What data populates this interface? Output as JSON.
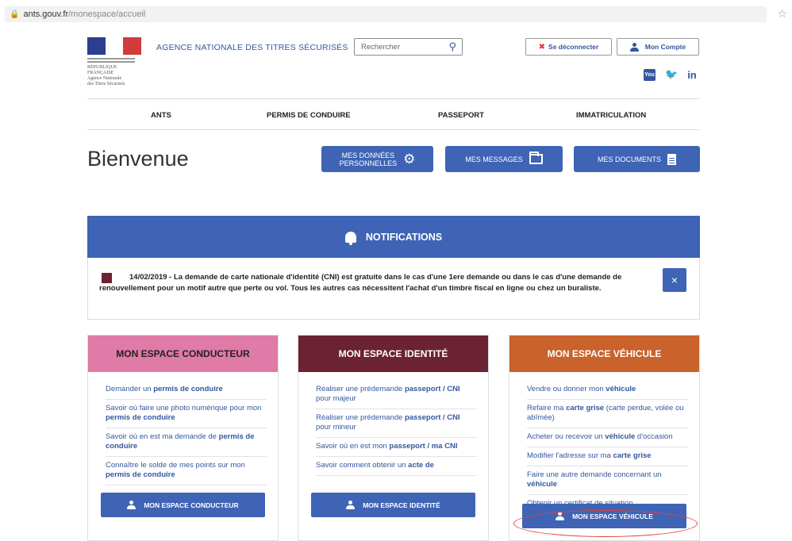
{
  "browser": {
    "url_host": "ants.gouv.fr",
    "url_path": "/monespace/accueil"
  },
  "header": {
    "agency": "AGENCE NATIONALE DES TITRES SÉCURISÉS",
    "search_placeholder": "Rechercher",
    "logout_label": "Se déconnecter",
    "account_label": "Mon Compte",
    "logo_lines": [
      "RÉPUBLIQUE FRANÇAISE",
      "Agence Nationale",
      "des Titres Sécurisés"
    ],
    "social": {
      "twitter": "🐦",
      "linkedin": "in",
      "youtube": "You"
    }
  },
  "nav": [
    "ANTS",
    "PERMIS DE CONDUIRE",
    "PASSEPORT",
    "IMMATRICULATION"
  ],
  "page_title": "Bienvenue",
  "top_buttons": {
    "donnees_line1": "MES DONNÉES",
    "donnees_line2": "PERSONNELLES",
    "messages": "MES MESSAGES",
    "documents": "MES DOCUMENTS"
  },
  "notifications": {
    "title": "NOTIFICATIONS",
    "text": "14/02/2019 - La demande de carte nationale d'identité (CNI) est gratuite dans le cas d'une 1ere demande ou dans le cas d'une demande de renouvellement pour un motif autre que perte ou vol. Tous les autres cas nécessitent l'achat d'un timbre fiscal en ligne ou chez un buraliste.",
    "close": "×"
  },
  "cards": {
    "conducteur": {
      "title": "MON ESPACE CONDUCTEUR",
      "color": "#e07aa6",
      "items": [
        {
          "pre": "Demander un ",
          "bold": "permis de conduire",
          "post": ""
        },
        {
          "pre": "Savoir où faire une photo numérique pour mon ",
          "bold": "permis de conduire",
          "post": ""
        },
        {
          "pre": "Savoir où en est ma demande de ",
          "bold": "permis de conduire",
          "post": ""
        },
        {
          "pre": "Connaître le solde de mes points sur mon ",
          "bold": "permis de conduire",
          "post": ""
        }
      ],
      "button": "MON ESPACE CONDUCTEUR"
    },
    "identite": {
      "title": "MON ESPACE IDENTITÉ",
      "color": "#6b2233",
      "items": [
        {
          "pre": "Réaliser une prédemande ",
          "bold": "passeport / CNI",
          "post": " pour majeur"
        },
        {
          "pre": "Réaliser une prédemande ",
          "bold": "passeport / CNI",
          "post": " pour mineur"
        },
        {
          "pre": "Savoir où en est mon ",
          "bold": "passeport / ma CNI",
          "post": ""
        },
        {
          "pre": "Savoir comment obtenir un ",
          "bold": "acte de",
          "post": ""
        }
      ],
      "button": "MON ESPACE IDENTITÉ"
    },
    "vehicule": {
      "title": "MON ESPACE VÉHICULE",
      "color": "#c9622b",
      "items": [
        {
          "pre": "Vendre ou donner mon ",
          "bold": "véhicule",
          "post": ""
        },
        {
          "pre": "Refaire ma ",
          "bold": "carte grise",
          "post": " (carte perdue, volée ou abîmée)"
        },
        {
          "pre": "Acheter ou recevoir un ",
          "bold": "véhicule",
          "post": " d'occasion"
        },
        {
          "pre": "Modifier l'adresse sur ma ",
          "bold": "carte grise",
          "post": ""
        },
        {
          "pre": "Faire une autre demande concernant un ",
          "bold": "véhicule",
          "post": ""
        },
        {
          "pre": "Obtenir un certificat de situation",
          "bold": "",
          "post": ""
        }
      ],
      "button": "MON ESPACE VÉHICULE"
    }
  }
}
